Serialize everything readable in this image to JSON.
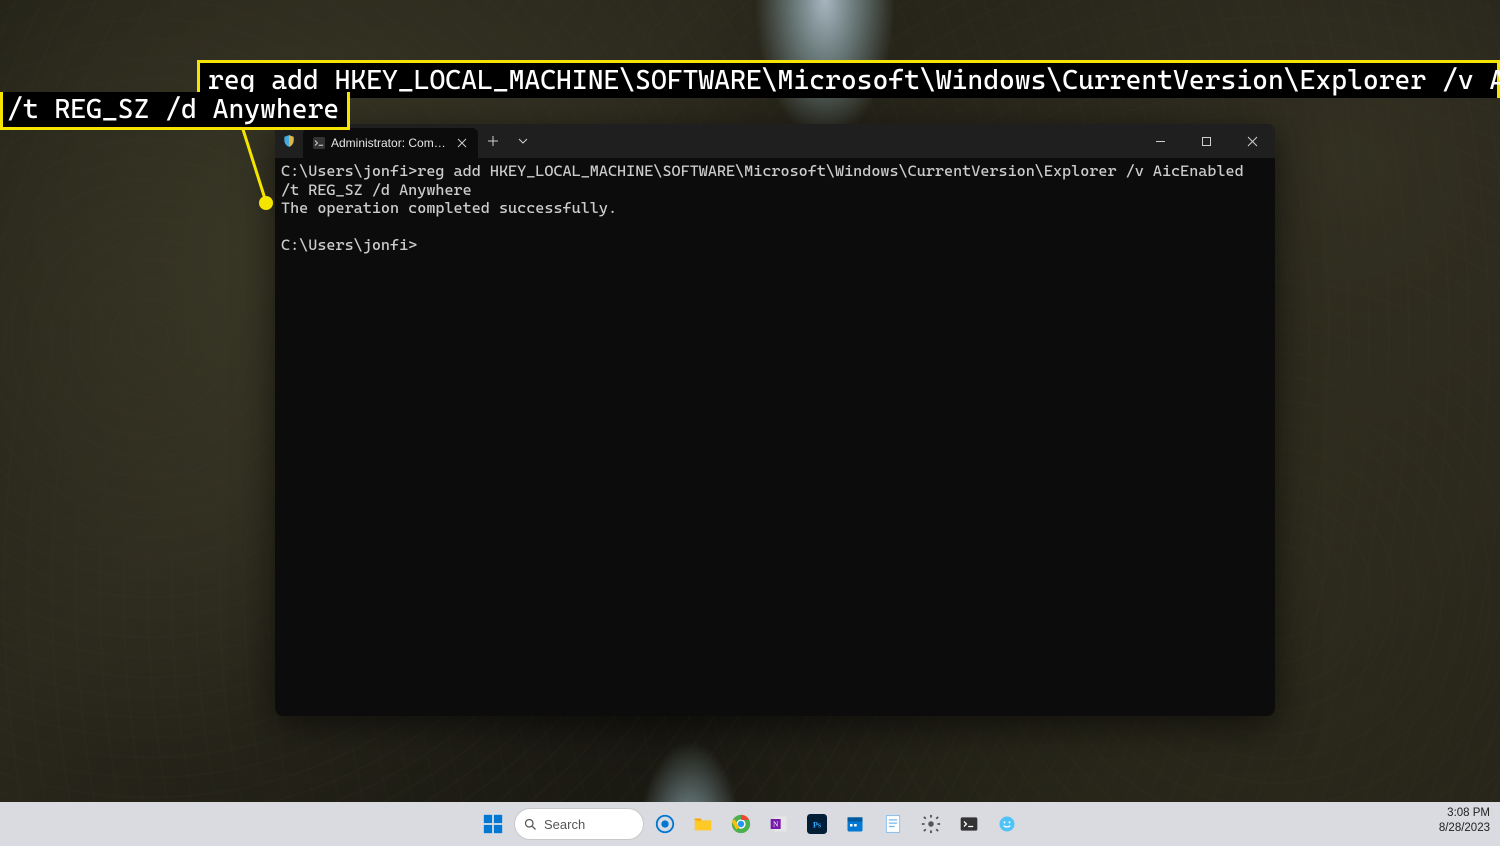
{
  "annotation": {
    "line1": "reg add HKEY_LOCAL_MACHINE\\SOFTWARE\\Microsoft\\Windows\\CurrentVersion\\Explorer /v AicEnabled",
    "line2": "/t REG_SZ /d Anywhere",
    "highlight_color": "#f4e400"
  },
  "terminal": {
    "tab_title": "Administrator: Command Pro",
    "lines": {
      "l1": "C:\\Users\\jonfi>reg add HKEY_LOCAL_MACHINE\\SOFTWARE\\Microsoft\\Windows\\CurrentVersion\\Explorer /v AicEnabled",
      "l2": "/t REG_SZ /d Anywhere",
      "l3": "The operation completed successfully.",
      "blank": "",
      "l4": "C:\\Users\\jonfi>"
    }
  },
  "taskbar": {
    "search_placeholder": "Search",
    "time": "3:08 PM",
    "date": "8/28/2023",
    "icons": [
      "start",
      "search",
      "copilot",
      "file-explorer",
      "chrome",
      "onenote",
      "photoshop",
      "calendar",
      "notepad",
      "settings",
      "terminal",
      "app"
    ]
  }
}
